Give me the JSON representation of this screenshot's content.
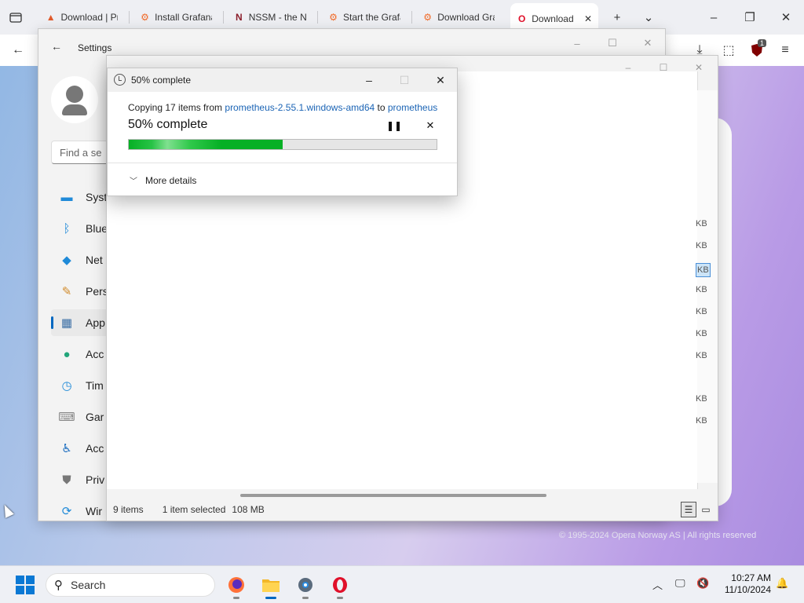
{
  "browser": {
    "tabs": [
      {
        "label": "Download | Pr",
        "icon": "flame-icon",
        "color": "#e05a2b"
      },
      {
        "label": "Install Grafana",
        "icon": "grafana-icon",
        "color": "#f06a28"
      },
      {
        "label": "NSSM - the No",
        "icon": "nssm-icon",
        "color": "#8b1e2b"
      },
      {
        "label": "Start the Grafa",
        "icon": "grafana-icon",
        "color": "#f06a28"
      },
      {
        "label": "Download Gra",
        "icon": "grafana-icon",
        "color": "#f06a28"
      },
      {
        "label": "Download |",
        "icon": "opera-icon",
        "color": "#e0102a"
      }
    ],
    "new_tab_glyph": "+",
    "tab_menu_glyph": "⌄",
    "extension_badge": "1"
  },
  "settings": {
    "title": "Settings",
    "search_placeholder": "Find a se",
    "nav": [
      {
        "label": "Syst",
        "icon": "monitor-icon",
        "color": "#1f8ad8"
      },
      {
        "label": "Blue",
        "icon": "bluetooth-icon",
        "color": "#1f8ad8"
      },
      {
        "label": "Net",
        "icon": "wifi-icon",
        "color": "#1f8ad8"
      },
      {
        "label": "Pers",
        "icon": "brush-icon",
        "color": "#d18a2a"
      },
      {
        "label": "App",
        "icon": "apps-icon",
        "color": "#3a6ea5",
        "selected": true
      },
      {
        "label": "Acc",
        "icon": "account-icon",
        "color": "#22a57a"
      },
      {
        "label": "Tim",
        "icon": "time-icon",
        "color": "#1f8ad8"
      },
      {
        "label": "Gar",
        "icon": "gamepad-icon",
        "color": "#888888"
      },
      {
        "label": "Acc",
        "icon": "accessibility-icon",
        "color": "#1f6fc0"
      },
      {
        "label": "Priv",
        "icon": "shield-icon",
        "color": "#777777"
      },
      {
        "label": "Wir",
        "icon": "update-icon",
        "color": "#1f8ad8"
      }
    ]
  },
  "explorer": {
    "size_cells": [
      "KB",
      "KB",
      "KB",
      "KB",
      "KB",
      "KB",
      "KB",
      "KB",
      "KB"
    ],
    "status": {
      "items": "9 items",
      "selected": "1 item selected",
      "size": "108 MB"
    }
  },
  "copy_dialog": {
    "title": "50% complete",
    "copy_prefix": "Copying 17 items from",
    "source": "prometheus-2.55.1.windows-amd64",
    "to_word": "to",
    "destination": "prometheus",
    "percent_label": "50% complete",
    "progress_percent": 50,
    "more_details": "More details"
  },
  "opera": {
    "footer": "© 1995-2024 Opera Norway AS | All rights reserved"
  },
  "taskbar": {
    "search_label": "Search",
    "time": "10:27 AM",
    "date": "11/10/2024"
  }
}
